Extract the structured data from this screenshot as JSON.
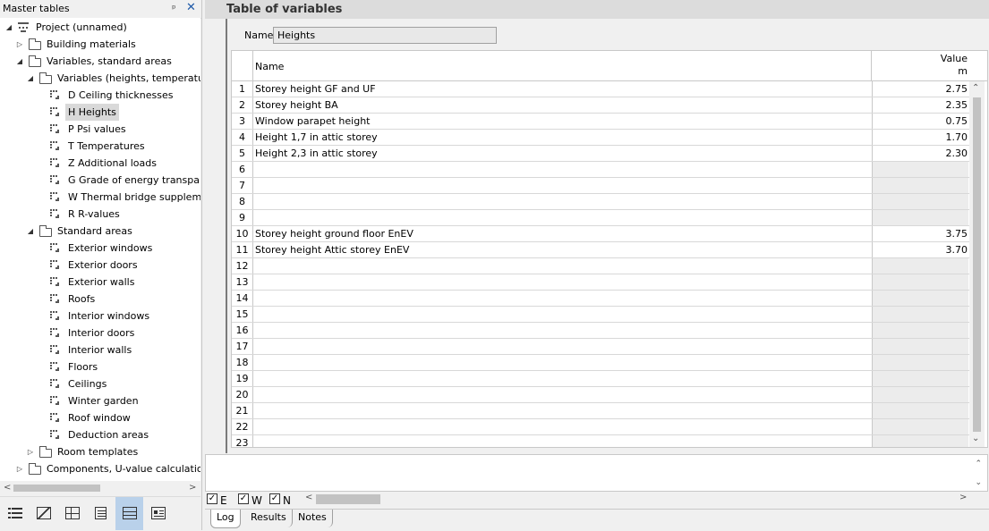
{
  "left_panel": {
    "title": "Master tables",
    "tree": [
      {
        "label": "Project (unnamed)",
        "icon": "project-icon",
        "expander": "expanded"
      },
      {
        "label": "Building materials",
        "icon": "folder-icon",
        "expander": "collapsed"
      },
      {
        "label": "Variables, standard areas",
        "icon": "folder-icon",
        "expander": "expanded"
      },
      {
        "label": "Variables (heights, temperatures, ...)",
        "icon": "folder-icon",
        "expander": "expanded"
      },
      {
        "label": "D Ceiling thicknesses",
        "icon": "table-icon"
      },
      {
        "label": "H Heights",
        "icon": "table-icon",
        "selected": true
      },
      {
        "label": "P Psi values",
        "icon": "table-icon"
      },
      {
        "label": "T Temperatures",
        "icon": "table-icon"
      },
      {
        "label": "Z Additional loads",
        "icon": "table-icon"
      },
      {
        "label": "G Grade of energy transparency",
        "icon": "table-icon"
      },
      {
        "label": "W Thermal bridge supplement",
        "icon": "table-icon"
      },
      {
        "label": "R R-values",
        "icon": "table-icon"
      },
      {
        "label": "Standard areas",
        "icon": "folder-icon",
        "expander": "expanded"
      },
      {
        "label": "Exterior windows",
        "icon": "table-icon"
      },
      {
        "label": "Exterior doors",
        "icon": "table-icon"
      },
      {
        "label": "Exterior walls",
        "icon": "table-icon"
      },
      {
        "label": "Roofs",
        "icon": "table-icon"
      },
      {
        "label": "Interior windows",
        "icon": "table-icon"
      },
      {
        "label": "Interior doors",
        "icon": "table-icon"
      },
      {
        "label": "Interior walls",
        "icon": "table-icon"
      },
      {
        "label": "Floors",
        "icon": "table-icon"
      },
      {
        "label": "Ceilings",
        "icon": "table-icon"
      },
      {
        "label": "Winter garden",
        "icon": "table-icon"
      },
      {
        "label": "Roof window",
        "icon": "table-icon"
      },
      {
        "label": "Deduction areas",
        "icon": "table-icon"
      },
      {
        "label": "Room templates",
        "icon": "folder-icon",
        "expander": "collapsed"
      },
      {
        "label": "Components, U-value calculation",
        "icon": "folder-icon",
        "expander": "collapsed"
      }
    ],
    "toolbar_icons": [
      "list-view-icon",
      "chart-view-icon",
      "room-view-icon",
      "document-view-icon",
      "table-view-icon",
      "form-view-icon"
    ],
    "active_toolbar_index": 4
  },
  "main": {
    "title": "Table of variables",
    "name_label": "Name",
    "name_value": "Heights",
    "columns": {
      "name": "Name",
      "value": "Value",
      "unit": "m"
    },
    "rows": [
      {
        "num": "1",
        "name": "Storey height GF and UF",
        "value": "2.75"
      },
      {
        "num": "2",
        "name": "Storey height BA",
        "value": "2.35"
      },
      {
        "num": "3",
        "name": "Window parapet height",
        "value": "0.75"
      },
      {
        "num": "4",
        "name": "Height 1,7 in attic storey",
        "value": "1.70"
      },
      {
        "num": "5",
        "name": "Height 2,3 in attic storey",
        "value": "2.30"
      },
      {
        "num": "6",
        "name": "",
        "value": ""
      },
      {
        "num": "7",
        "name": "",
        "value": ""
      },
      {
        "num": "8",
        "name": "",
        "value": ""
      },
      {
        "num": "9",
        "name": "",
        "value": ""
      },
      {
        "num": "10",
        "name": "Storey height ground floor EnEV",
        "value": "3.75"
      },
      {
        "num": "11",
        "name": "Storey height Attic storey EnEV",
        "value": "3.70"
      },
      {
        "num": "12",
        "name": "",
        "value": ""
      },
      {
        "num": "13",
        "name": "",
        "value": ""
      },
      {
        "num": "14",
        "name": "",
        "value": ""
      },
      {
        "num": "15",
        "name": "",
        "value": ""
      },
      {
        "num": "16",
        "name": "",
        "value": ""
      },
      {
        "num": "17",
        "name": "",
        "value": ""
      },
      {
        "num": "18",
        "name": "",
        "value": ""
      },
      {
        "num": "19",
        "name": "",
        "value": ""
      },
      {
        "num": "20",
        "name": "",
        "value": ""
      },
      {
        "num": "21",
        "name": "",
        "value": ""
      },
      {
        "num": "22",
        "name": "",
        "value": ""
      },
      {
        "num": "23",
        "name": "",
        "value": ""
      }
    ]
  },
  "log": {
    "filters": [
      {
        "label": "E",
        "checked": true
      },
      {
        "label": "W",
        "checked": true
      },
      {
        "label": "N",
        "checked": true
      }
    ],
    "tabs": [
      "Log",
      "Results",
      "Notes"
    ],
    "active_tab": "Log"
  }
}
